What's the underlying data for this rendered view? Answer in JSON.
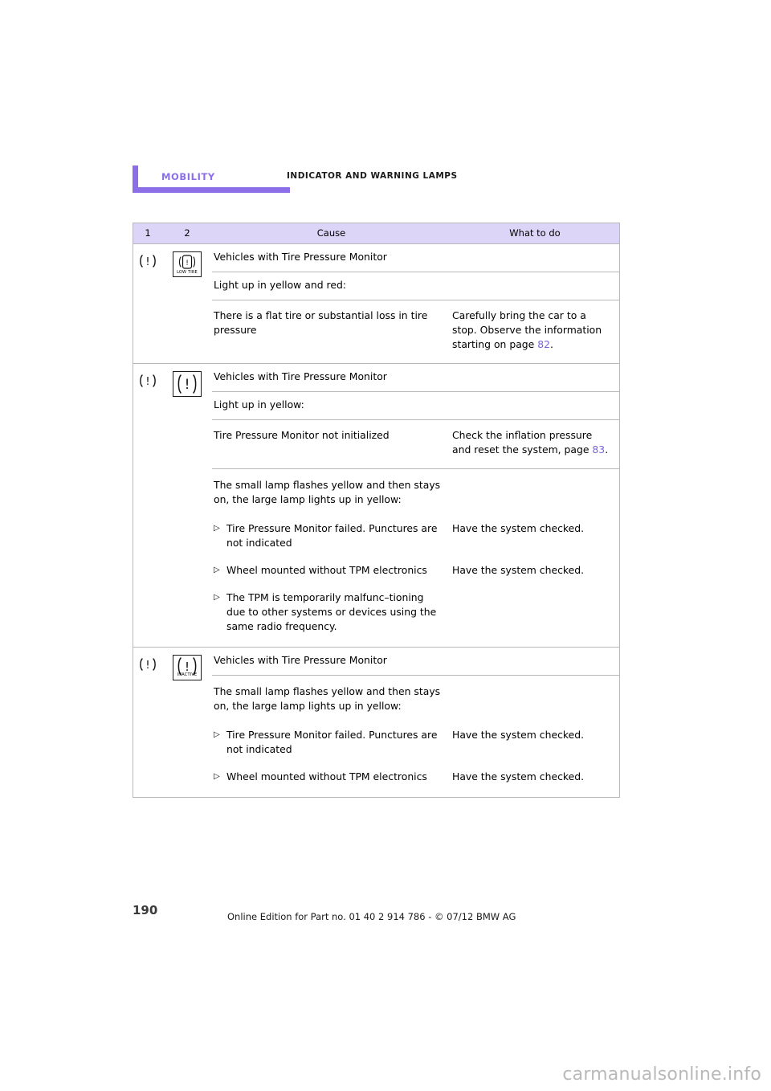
{
  "header": {
    "section": "MOBILITY",
    "title": "INDICATOR AND WARNING LAMPS"
  },
  "table": {
    "columns": {
      "col1": "1",
      "col2": "2",
      "cause": "Cause",
      "what": "What to do"
    },
    "blocks": [
      {
        "lamp1": "tire-pressure-warning-small-icon",
        "lamp2": "low-tire-icon",
        "lamp2_caption": "LOW TIRE",
        "rows": [
          {
            "type": "full",
            "text": "Vehicles with Tire Pressure Monitor"
          },
          {
            "type": "full",
            "text": "Light up in yellow and red:"
          },
          {
            "type": "pair",
            "cause": "There is a flat tire or substantial loss in tire pressure",
            "what_before": "Carefully bring the car to a stop. Observe the information starting on page ",
            "what_link": "82",
            "what_after": "."
          }
        ]
      },
      {
        "lamp1": "tire-pressure-warning-small-icon",
        "lamp2": "tire-pressure-warning-boxed-icon",
        "lamp2_caption": "",
        "rows": [
          {
            "type": "full",
            "text": "Vehicles with Tire Pressure Monitor"
          },
          {
            "type": "full",
            "text": "Light up in yellow:"
          },
          {
            "type": "pair",
            "cause": "Tire Pressure Monitor not initialized",
            "what_before": "Check the inflation pressure and reset the system, page ",
            "what_link": "83",
            "what_after": "."
          },
          {
            "type": "bullets",
            "intro": "The small lamp flashes yellow and then stays on, the large lamp lights up in yellow:",
            "items": [
              {
                "cause": "Tire Pressure Monitor failed. Punctures are not indicated",
                "what": "Have the system checked."
              },
              {
                "cause": "Wheel mounted without TPM electronics",
                "what": "Have the system checked."
              },
              {
                "cause": "The TPM is temporarily malfunc–tioning due to other systems or devices using the same radio frequency.",
                "what": ""
              }
            ]
          }
        ]
      },
      {
        "lamp1": "tire-pressure-warning-small-icon",
        "lamp2": "tire-pressure-inactive-icon",
        "lamp2_caption": "INACTIVE",
        "rows": [
          {
            "type": "full",
            "text": "Vehicles with Tire Pressure Monitor"
          },
          {
            "type": "bullets",
            "intro": "The small lamp flashes yellow and then stays on, the large lamp lights up in yellow:",
            "items": [
              {
                "cause": "Tire Pressure Monitor failed. Punctures are not indicated",
                "what": "Have the system checked."
              },
              {
                "cause": "Wheel mounted without TPM electronics",
                "what": "Have the system checked."
              }
            ]
          }
        ]
      }
    ]
  },
  "footer": {
    "page_number": "190",
    "note": "Online Edition for Part no. 01 40 2 914 786 - © 07/12 BMW AG",
    "watermark": "carmanualsonline.info"
  },
  "colors": {
    "accent": "#8C6FE8",
    "header_row_bg": "#DCD5F7",
    "link": "#7B63D8",
    "border": "#b8b8b8"
  }
}
